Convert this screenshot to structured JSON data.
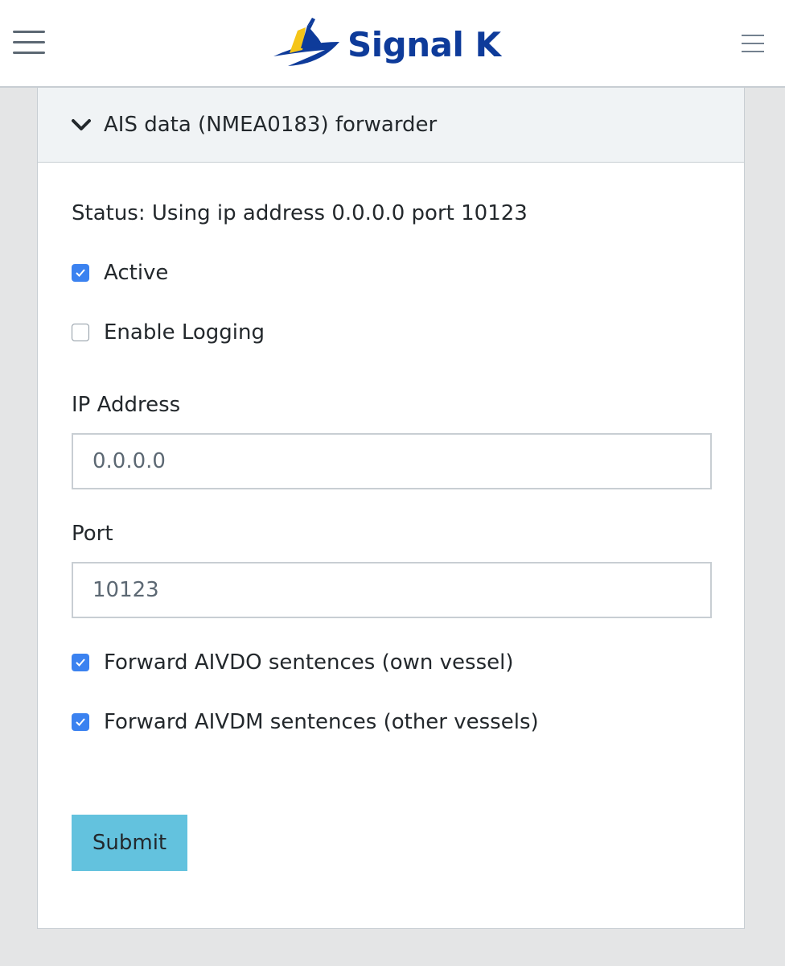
{
  "header": {
    "brand_name": "Signal K",
    "brand_color": "#0e3b9a",
    "left_menu_icon": "hamburger-icon",
    "right_menu_icon": "hamburger-icon"
  },
  "panel": {
    "title": "AIS data (NMEA0183) forwarder",
    "expanded": true,
    "status": "Status: Using ip address 0.0.0.0 port 10123",
    "active": {
      "label": "Active",
      "checked": true
    },
    "logging": {
      "label": "Enable Logging",
      "checked": false
    },
    "ip_address": {
      "label": "IP Address",
      "value": "0.0.0.0"
    },
    "port": {
      "label": "Port",
      "value": "10123"
    },
    "aivdo": {
      "label": "Forward AIVDO sentences (own vessel)",
      "checked": true
    },
    "aivdm": {
      "label": "Forward AIVDM sentences (other vessels)",
      "checked": true
    },
    "submit_label": "Submit",
    "colors": {
      "accent": "#63c2de",
      "checkbox": "#3b82f0"
    }
  }
}
